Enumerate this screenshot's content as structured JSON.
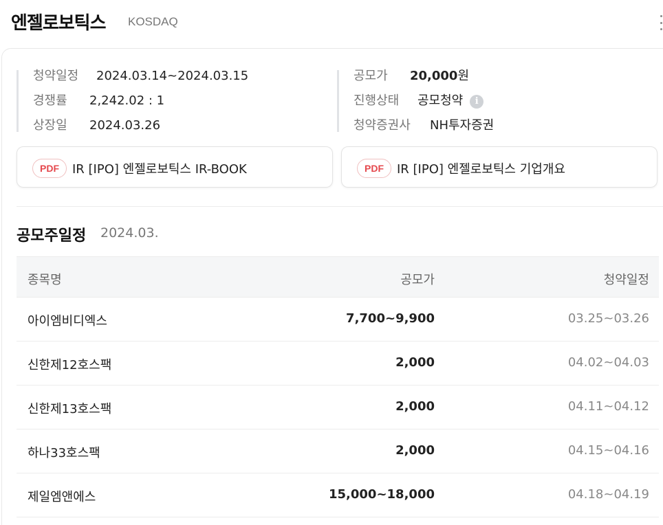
{
  "header": {
    "company": "엔젤로보틱스",
    "market": "KOSDAQ"
  },
  "info": {
    "left": [
      {
        "label": "청약일정",
        "value": "2024.03.14~2024.03.15"
      },
      {
        "label": "경쟁률",
        "value": "2,242.02 : 1"
      },
      {
        "label": "상장일",
        "value": "2024.03.26"
      }
    ],
    "right": {
      "offer_price_label": "공모가",
      "offer_price_value": "20,000",
      "offer_price_unit": "원",
      "status_label": "진행상태",
      "status_value": "공모청약",
      "underwriter_label": "청약증권사",
      "underwriter_value": "NH투자증권"
    }
  },
  "documents": [
    {
      "badge": "PDF",
      "label": "IR [IPO] 엔젤로보틱스 IR-BOOK"
    },
    {
      "badge": "PDF",
      "label": "IR [IPO] 엔젤로보틱스 기업개요"
    }
  ],
  "schedule": {
    "title": "공모주일정",
    "month": "2024.03.",
    "columns": [
      "종목명",
      "공모가",
      "청약일정"
    ],
    "rows": [
      {
        "name": "아이엠비디엑스",
        "price": "7,700~9,900",
        "dates": "03.25~03.26"
      },
      {
        "name": "신한제12호스팩",
        "price": "2,000",
        "dates": "04.02~04.03"
      },
      {
        "name": "신한제13호스팩",
        "price": "2,000",
        "dates": "04.11~04.12"
      },
      {
        "name": "하나33호스팩",
        "price": "2,000",
        "dates": "04.15~04.16"
      },
      {
        "name": "제일엠앤에스",
        "price": "15,000~18,000",
        "dates": "04.18~04.19"
      }
    ]
  },
  "icons": {
    "more": "more-vertical-icon",
    "status_info": "info-icon",
    "pdf": "pdf-icon"
  },
  "colors": {
    "pdf_badge": "#e5484d",
    "label_gray": "#777777",
    "header_bg": "#f5f6f7"
  }
}
